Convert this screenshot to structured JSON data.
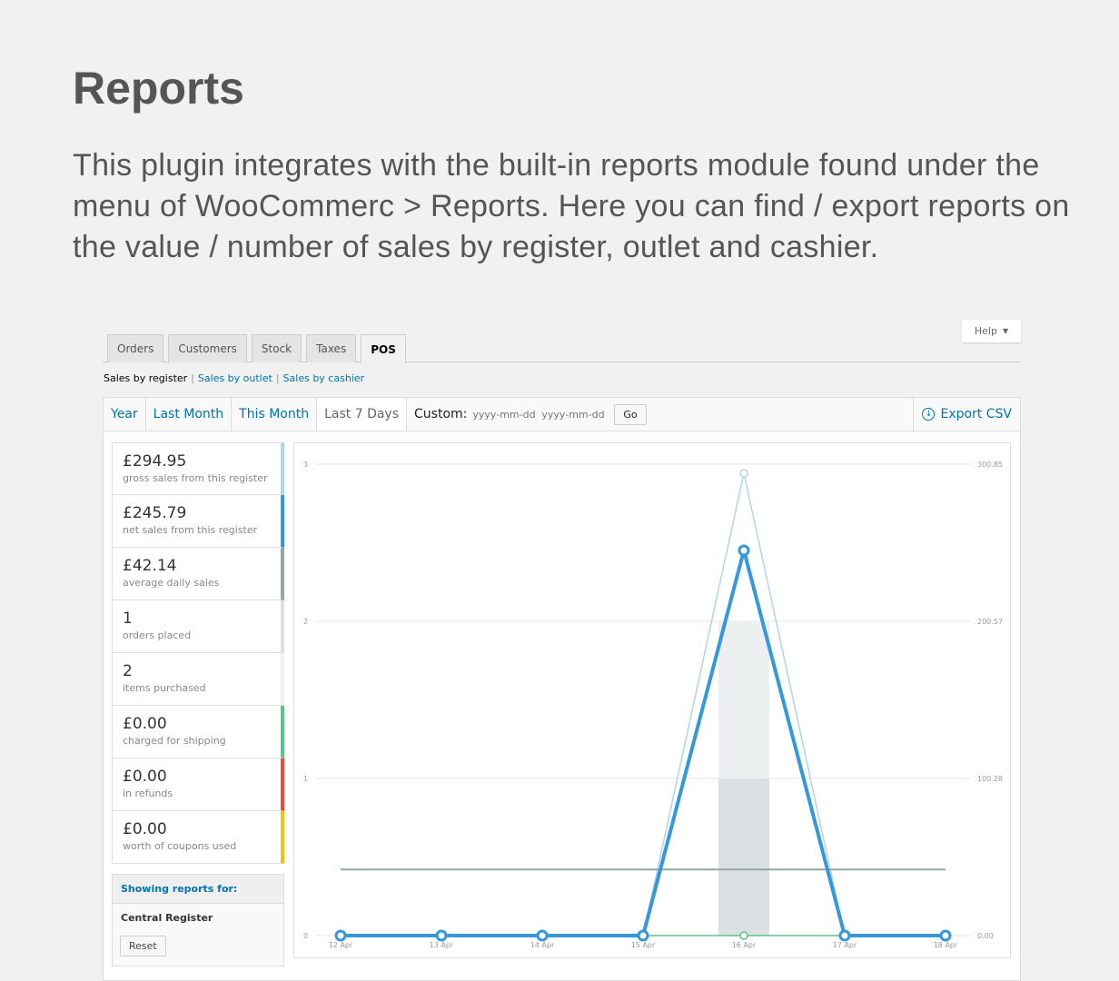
{
  "heading": {
    "title": "Reports",
    "description": "This plugin integrates with the built-in reports module found under the menu of WooCommerc > Reports. Here you can find / export reports on the value / number of sales by register, outlet and cashier."
  },
  "help_label": "Help",
  "tabs": [
    {
      "label": "Orders"
    },
    {
      "label": "Customers"
    },
    {
      "label": "Stock"
    },
    {
      "label": "Taxes"
    },
    {
      "label": "POS",
      "active": true
    }
  ],
  "subnav": {
    "current": "Sales by register",
    "links": [
      "Sales by outlet",
      "Sales by cashier"
    ]
  },
  "ranges": [
    {
      "label": "Year"
    },
    {
      "label": "Last Month"
    },
    {
      "label": "This Month"
    },
    {
      "label": "Last 7 Days",
      "active": true
    }
  ],
  "custom": {
    "label": "Custom:",
    "from_placeholder": "yyyy-mm-dd",
    "to_placeholder": "yyyy-mm-dd",
    "go": "Go"
  },
  "export_label": "Export CSV",
  "legend": [
    {
      "value": "£294.95",
      "label": "gross sales from this register",
      "color": "#b1d4ea"
    },
    {
      "value": "£245.79",
      "label": "net sales from this register",
      "color": "#3498db"
    },
    {
      "value": "£42.14",
      "label": "average daily sales",
      "color": "#95a5a6"
    },
    {
      "value": "1",
      "label": "orders placed",
      "color": "#dbe1e3"
    },
    {
      "value": "2",
      "label": "items purchased",
      "color": "#ecf0f1"
    },
    {
      "value": "£0.00",
      "label": "charged for shipping",
      "color": "#5cc488"
    },
    {
      "value": "£0.00",
      "label": "in refunds",
      "color": "#e74c3c"
    },
    {
      "value": "£0.00",
      "label": "worth of coupons used",
      "color": "#f1c40f"
    }
  ],
  "showing": {
    "title": "Showing reports for:",
    "register": "Central Register",
    "reset": "Reset"
  },
  "chart_data": {
    "type": "line",
    "categories": [
      "12 Apr",
      "13 Apr",
      "14 Apr",
      "15 Apr",
      "16 Apr",
      "17 Apr",
      "18 Apr"
    ],
    "left_ticks": [
      "0",
      "1",
      "2",
      "3"
    ],
    "left_ylim": [
      0,
      3
    ],
    "right_ticks": [
      "0.00",
      "100.28",
      "200.57",
      "300.85"
    ],
    "right_ylim": [
      0,
      300.85
    ],
    "bars": [
      {
        "values": [
          0,
          0,
          0,
          0,
          2,
          0,
          0
        ],
        "color": "#ecf0f1",
        "axis": "left"
      },
      {
        "values": [
          0,
          0,
          0,
          0,
          1,
          0,
          0
        ],
        "color": "#dbe1e3",
        "axis": "left"
      }
    ],
    "series": [
      {
        "values": [
          0,
          0,
          0,
          0,
          294.95,
          0,
          0
        ],
        "color": "#b1d4ea",
        "axis": "right",
        "width": 1.5
      },
      {
        "values": [
          0,
          0,
          0,
          0,
          0,
          0,
          0
        ],
        "color": "#5cc488",
        "axis": "right",
        "width": 1.5
      },
      {
        "values": [
          42.14,
          42.14,
          42.14,
          42.14,
          42.14,
          42.14,
          42.14
        ],
        "color": "#95a5a6",
        "axis": "right",
        "width": 2,
        "nopoints": true
      },
      {
        "values": [
          0,
          0,
          0,
          0,
          245.79,
          0,
          0
        ],
        "color": "#3498db",
        "axis": "right",
        "width": 4
      }
    ],
    "grid": true
  }
}
